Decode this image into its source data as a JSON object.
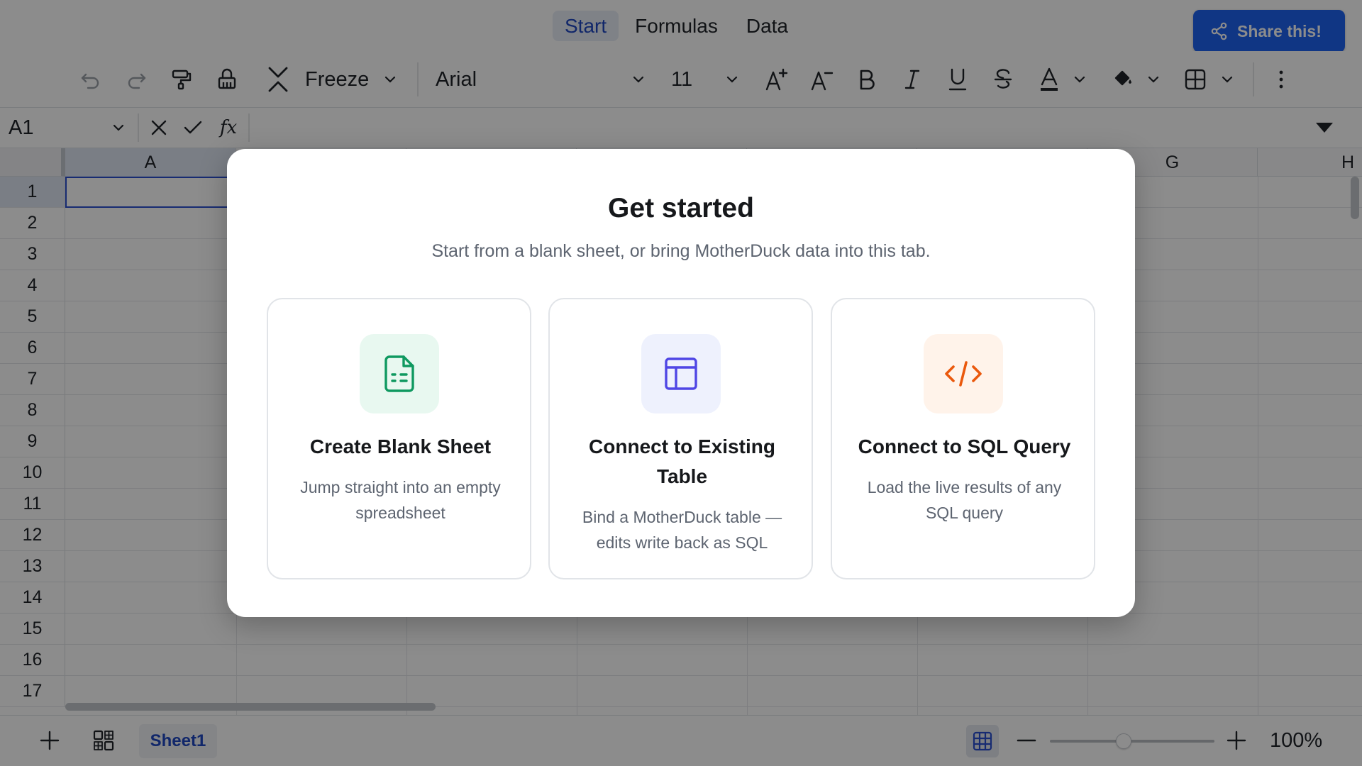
{
  "menu": {
    "tabs": [
      {
        "label": "Start",
        "active": true
      },
      {
        "label": "Formulas",
        "active": false
      },
      {
        "label": "Data",
        "active": false
      }
    ],
    "share_label": "Share this!"
  },
  "toolbar": {
    "freeze_label": "Freeze",
    "font_name": "Arial",
    "font_size": "11"
  },
  "formula_bar": {
    "cell_ref": "A1",
    "fx_label": "fx"
  },
  "grid": {
    "columns": [
      "A",
      "G",
      "H"
    ],
    "rows": [
      "1",
      "2",
      "3",
      "4",
      "5",
      "6",
      "7",
      "8",
      "9",
      "10",
      "11",
      "12",
      "13",
      "14",
      "15",
      "16",
      "17"
    ]
  },
  "bottom": {
    "sheet_name": "Sheet1",
    "zoom_value": 0.45,
    "zoom_label": "100%"
  },
  "modal": {
    "title": "Get started",
    "subtitle": "Start from a blank sheet, or bring MotherDuck data into this tab.",
    "cards": [
      {
        "title": "Create Blank Sheet",
        "description": "Jump straight into an empty spreadsheet",
        "icon": "file-spreadsheet-icon",
        "icon_bg": "#e8f8f0",
        "icon_color": "#0f9960"
      },
      {
        "title": "Connect to Existing Table",
        "description": "Bind a MotherDuck table — edits write back as SQL",
        "icon": "table-icon",
        "icon_bg": "#eef1fd",
        "icon_color": "#4f46e5"
      },
      {
        "title": "Connect to SQL Query",
        "description": "Load the live results of any SQL query",
        "icon": "code-icon",
        "icon_bg": "#fff3ea",
        "icon_color": "#ea580c"
      }
    ]
  },
  "colors": {
    "accent": "#1e63f0",
    "active_tab_text": "#1f47c2"
  }
}
